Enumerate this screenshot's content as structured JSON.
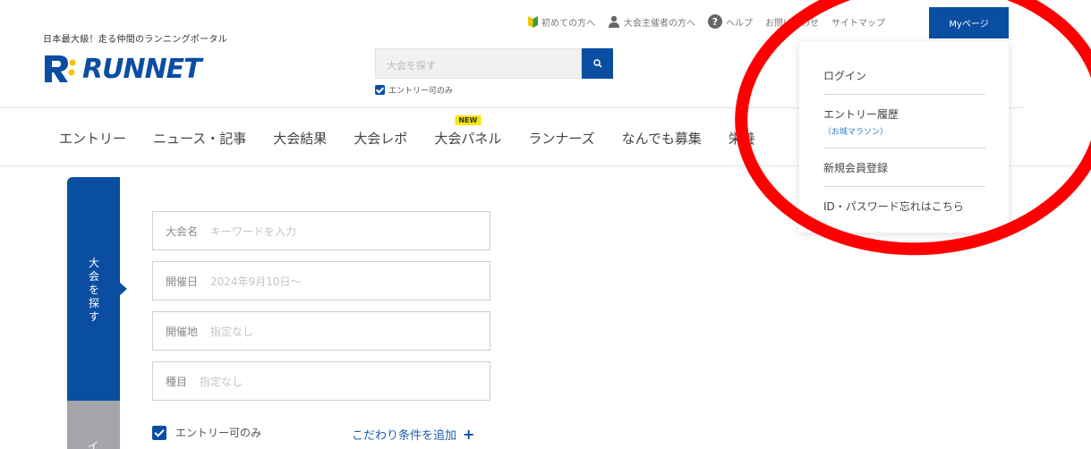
{
  "header": {
    "tagline": "日本最大級！走る仲間のランニングポータル",
    "logo_text": "RUNNET",
    "search": {
      "placeholder": "大会を探す"
    },
    "entry_only_label": "エントリー可のみ",
    "top_links": {
      "beginners": "初めての方へ",
      "organizers": "大会主催者の方へ",
      "help": "ヘルプ",
      "contact": "お問い合わせ",
      "sitemap": "サイトマップ"
    },
    "mypage_label": "Myページ"
  },
  "nav": {
    "items": [
      {
        "label": "エントリー"
      },
      {
        "label": "ニュース・記事"
      },
      {
        "label": "大会結果"
      },
      {
        "label": "大会レポ"
      },
      {
        "label": "大会パネル",
        "badge": "NEW"
      },
      {
        "label": "ランナーズ"
      },
      {
        "label": "なんでも募集"
      },
      {
        "label": "栄養"
      }
    ]
  },
  "dropdown": {
    "login": "ログイン",
    "entry_history": "エントリー履歴",
    "entry_history_sub": "（お城マラソン）",
    "register": "新規会員登録",
    "forgot": "ID・パスワード忘れはこちら"
  },
  "side_tabs": {
    "search_label": "大会を探す",
    "second_label": "イ"
  },
  "form": {
    "name": {
      "label": "大会名",
      "placeholder": "キーワードを入力"
    },
    "date": {
      "label": "開催日",
      "placeholder": "2024年9月10日〜"
    },
    "place": {
      "label": "開催地",
      "placeholder": "指定なし"
    },
    "event": {
      "label": "種目",
      "placeholder": "指定なし"
    },
    "entry_only_label": "エントリー可のみ",
    "add_condition": "こだわり条件を追加"
  },
  "colors": {
    "brand_blue": "#0a4ea2",
    "link_blue": "#2a7bc6",
    "annotation_red": "#ff0000",
    "new_badge": "#f6e600"
  }
}
